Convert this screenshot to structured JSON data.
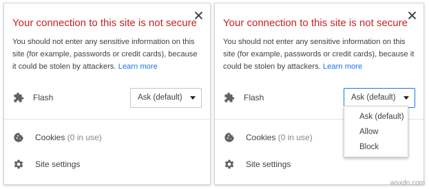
{
  "popups": [
    {
      "title": "Your connection to this site is not secure",
      "description": "You should not enter any sensitive information on this site (for example, passwords or credit cards), because it could be stolen by attackers.",
      "learn_more": "Learn more",
      "permission": {
        "label": "Flash",
        "icon": "puzzle-icon",
        "value": "Ask (default)"
      },
      "cookies": {
        "label": "Cookies",
        "count": "(0 in use)",
        "icon": "cookie-icon"
      },
      "site_settings": {
        "label": "Site settings",
        "icon": "gear-icon"
      },
      "close_icon": "close-icon"
    },
    {
      "title": "Your connection to this site is not secure",
      "description": "You should not enter any sensitive information on this site (for example, passwords or credit cards), because it could be stolen by attackers.",
      "learn_more": "Learn more",
      "permission": {
        "label": "Flash",
        "icon": "puzzle-icon",
        "value": "Ask (default)",
        "expanded": true
      },
      "cookies": {
        "label": "Cookies",
        "count": "(0 in use)",
        "icon": "cookie-icon"
      },
      "site_settings": {
        "label": "Site settings",
        "icon": "gear-icon"
      },
      "close_icon": "close-icon"
    }
  ],
  "dropdown_options": [
    "Ask (default)",
    "Allow",
    "Block"
  ],
  "watermark": "wsxdn.com",
  "colors": {
    "title": "#c5221f",
    "link": "#1a73e8",
    "focus_border": "#1a73e8",
    "text": "#3c4043",
    "muted": "#80868b"
  }
}
